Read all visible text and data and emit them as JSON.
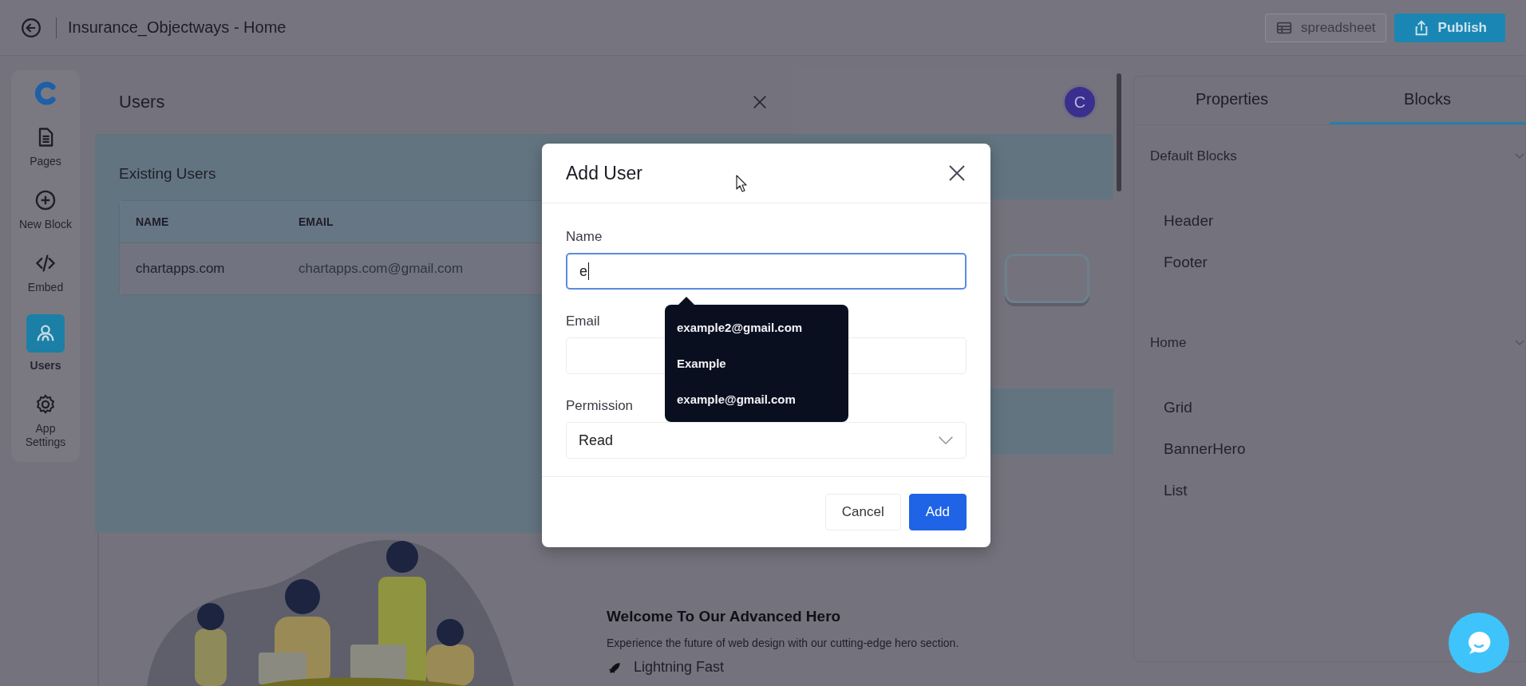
{
  "header": {
    "title": "Insurance_Objectways - Home",
    "buttons": [
      {
        "label": "spreadsheet",
        "kind": "outline"
      },
      {
        "label": "Publish",
        "kind": "primary"
      }
    ]
  },
  "sidebar": {
    "items": [
      {
        "label": "Pages",
        "kind": "pages",
        "selected": false
      },
      {
        "label": "New Block",
        "kind": "add",
        "selected": false
      },
      {
        "label": "Embed",
        "kind": "code",
        "selected": false
      },
      {
        "label": "Users",
        "kind": "users",
        "selected": true
      },
      {
        "label": "App Settings",
        "kind": "settings",
        "selected": false
      }
    ]
  },
  "users_panel": {
    "title": "Users",
    "section_title": "Existing Users",
    "table": {
      "columns": [
        "NAME",
        "EMAIL"
      ],
      "rows": [
        [
          "chartapps.com",
          "chartapps.com@gmail.com"
        ]
      ]
    }
  },
  "canvas": {
    "avatar": "C",
    "hero": {
      "title": "Welcome To Our Advanced Hero",
      "subtitle": "Experience the future of web design with our cutting-edge hero section.",
      "features": [
        "Lightning Fast"
      ]
    }
  },
  "right_panel": {
    "tabs": [
      {
        "label": "Properties",
        "selected": false
      },
      {
        "label": "Blocks",
        "selected": true
      }
    ],
    "groups": [
      {
        "title": "Default Blocks",
        "expanded": true,
        "items": [
          "Header",
          "Footer"
        ]
      },
      {
        "title": "Home",
        "expanded": true,
        "items": [
          "Grid",
          "BannerHero",
          "List"
        ]
      }
    ]
  },
  "dialog": {
    "title": "Add User",
    "fields": [
      {
        "label": "Name",
        "kind": "text",
        "value": "e",
        "focused": true
      },
      {
        "label": "Email",
        "kind": "text",
        "focused": false
      },
      {
        "label": "Permission",
        "kind": "select",
        "value": "Read",
        "focused": false
      }
    ],
    "suggestions": [
      "example2@gmail.com",
      "Example",
      "example@gmail.com"
    ],
    "buttons": [
      {
        "label": "Cancel",
        "kind": "secondary"
      },
      {
        "label": "Add",
        "kind": "primary"
      }
    ]
  }
}
